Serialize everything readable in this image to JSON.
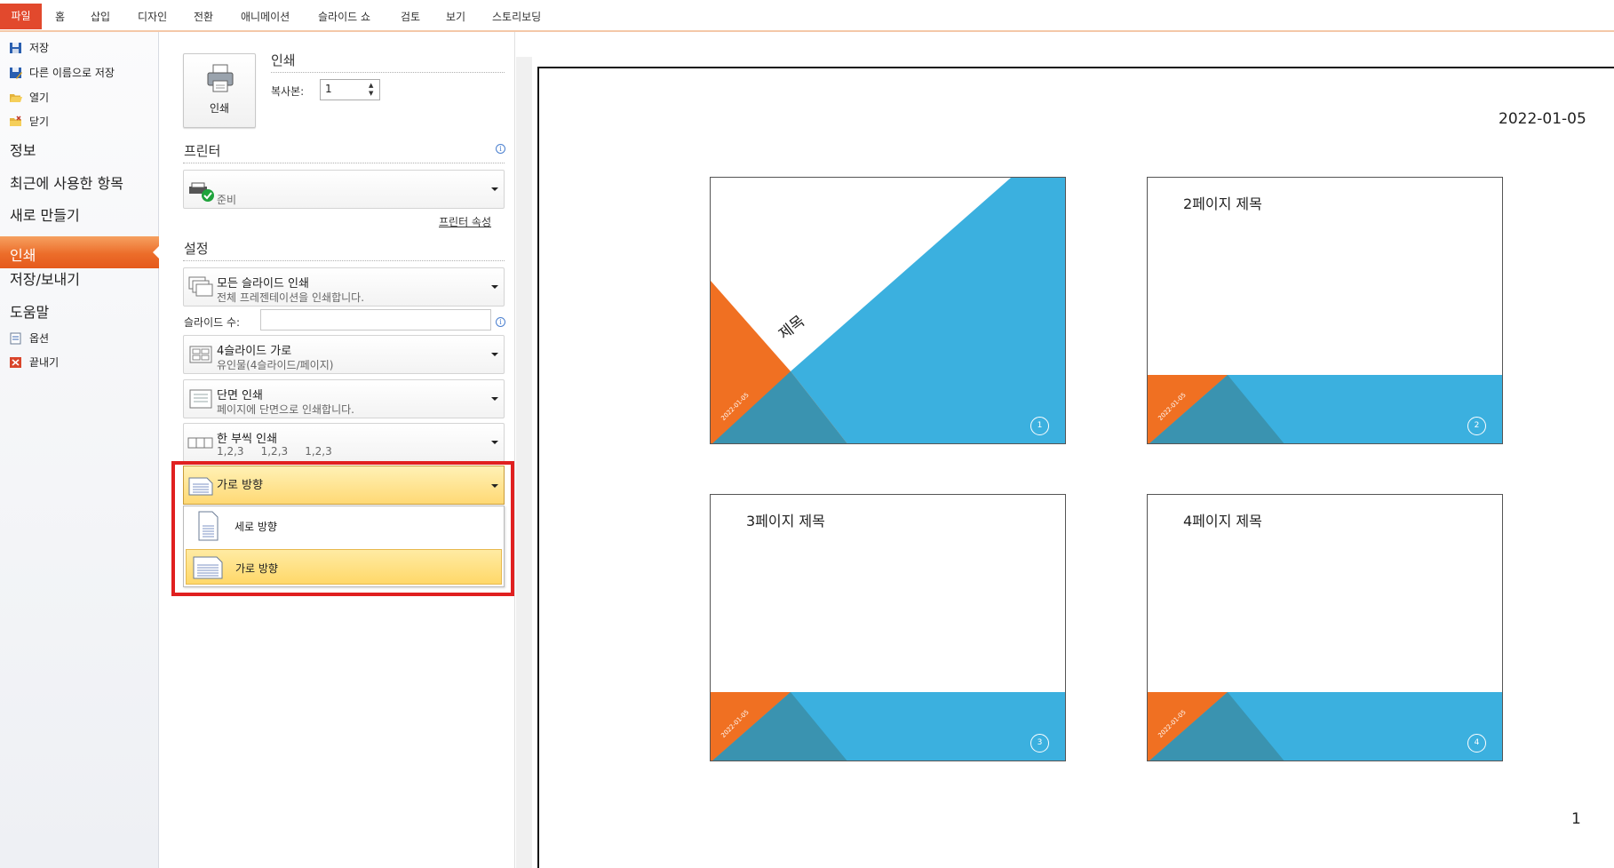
{
  "ribbon": {
    "file_tab": "파일",
    "tabs": [
      "홈",
      "삽입",
      "디자인",
      "전환",
      "애니메이션",
      "슬라이드 쇼",
      "검토",
      "보기",
      "스토리보딩"
    ]
  },
  "nav": {
    "small_items": [
      {
        "label": "저장",
        "icon": "save-icon"
      },
      {
        "label": "다른 이름으로 저장",
        "icon": "save-as-icon"
      },
      {
        "label": "열기",
        "icon": "open-folder-icon"
      },
      {
        "label": "닫기",
        "icon": "close-folder-icon"
      }
    ],
    "big_items": [
      "정보",
      "최근에 사용한 항목",
      "새로 만들기"
    ],
    "active": "인쇄",
    "big_items_after": [
      "저장/보내기",
      "도움말"
    ],
    "bottom_items": [
      {
        "label": "옵션",
        "icon": "options-icon"
      },
      {
        "label": "끝내기",
        "icon": "exit-icon"
      }
    ]
  },
  "print": {
    "button_label": "인쇄",
    "section_title": "인쇄",
    "copies_label": "복사본:",
    "copies_value": "1"
  },
  "printer": {
    "section_title": "프린터",
    "status": "준비",
    "properties_link": "프린터 속성"
  },
  "settings": {
    "section_title": "설정",
    "slides_range": {
      "title": "모든 슬라이드 인쇄",
      "subtitle": "전체 프레젠테이션을 인쇄합니다."
    },
    "slides_label": "슬라이드 수:",
    "layout": {
      "title": "4슬라이드 가로",
      "subtitle": "유인물(4슬라이드/페이지)"
    },
    "sides": {
      "title": "단면 인쇄",
      "subtitle": "페이지에 단면으로 인쇄합니다."
    },
    "collate": {
      "title": "한 부씩 인쇄",
      "subtitle": "1,2,3     1,2,3     1,2,3"
    },
    "orientation": {
      "selected": "가로 방향",
      "options": [
        "세로 방향",
        "가로 방향"
      ]
    }
  },
  "preview": {
    "header_date": "2022-01-05",
    "page_number": "1",
    "slides": [
      {
        "title": "제목",
        "number": "1",
        "date": "2022-01-05"
      },
      {
        "title": "2페이지 제목",
        "number": "2",
        "date": "2022-01-05"
      },
      {
        "title": "3페이지 제목",
        "number": "3",
        "date": "2022-01-05"
      },
      {
        "title": "4페이지 제목",
        "number": "4",
        "date": "2022-01-05"
      }
    ]
  },
  "colors": {
    "accent_orange": "#f07022",
    "slide_blue": "#3bb0df",
    "slide_overlap": "#3a93b0",
    "highlight_red": "#e02020"
  }
}
